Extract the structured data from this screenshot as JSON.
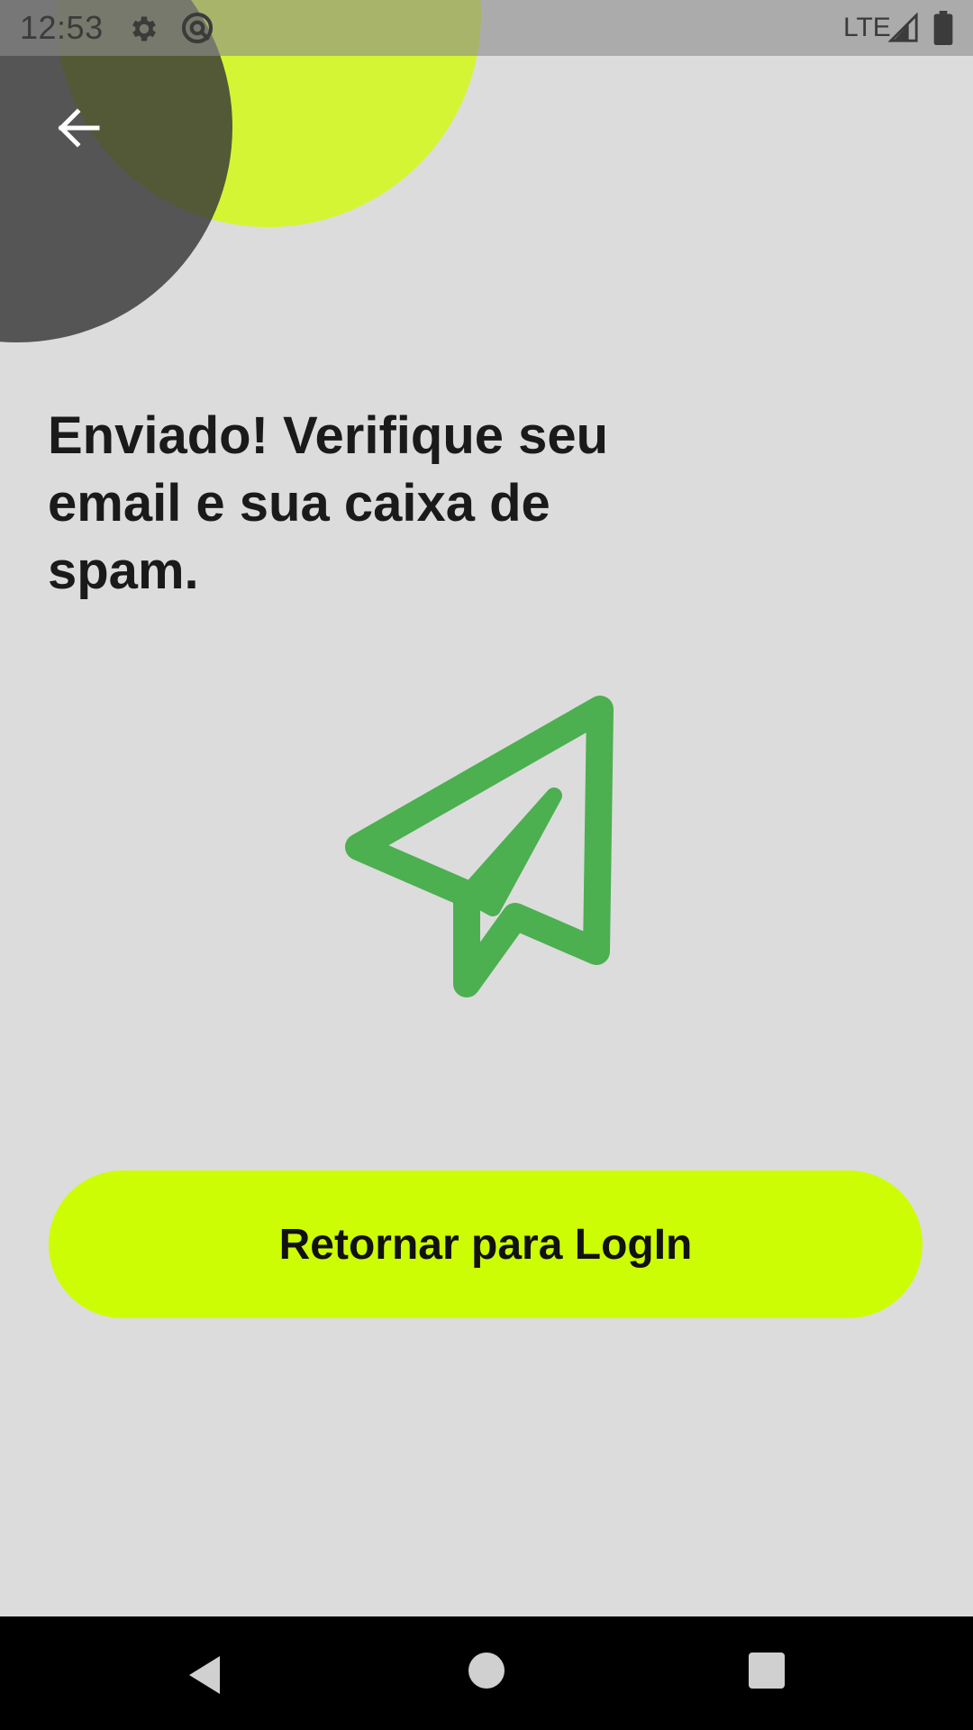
{
  "status_bar": {
    "time": "12:53",
    "network_label": "LTE",
    "icons": [
      "gear-icon",
      "at-sign-icon",
      "signal-icon",
      "battery-icon"
    ]
  },
  "header": {
    "back_icon": "arrow-left-icon"
  },
  "main": {
    "title": "Enviado! Verifique seu email e sua caixa de spam.",
    "illustration_icon": "paper-plane-icon",
    "return_button_label": "Retornar para LogIn"
  },
  "navigation_bar": {
    "icons": [
      "nav-back-icon",
      "nav-home-icon",
      "nav-recents-icon"
    ]
  },
  "colors": {
    "background": "#dcdcdc",
    "accent_lime": "#cdfd05",
    "decor_lime": "#d4f533",
    "decor_dark": "#373737",
    "plane_green": "#4caf50",
    "title_text": "#1a1a1a"
  }
}
